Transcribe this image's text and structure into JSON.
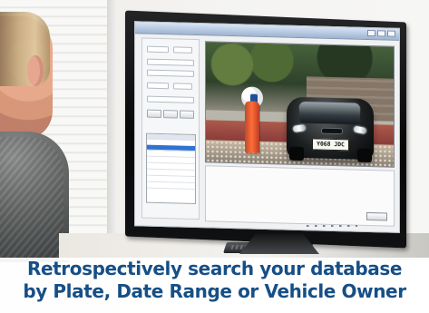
{
  "overlay": {
    "headline_line_1": "Retrospectively search your database",
    "headline_line_2": "by Plate, Date Range or Vehicle Owner"
  },
  "screen": {
    "plate_text": "Y068 JDC"
  },
  "colors": {
    "headline": "#164f86",
    "accent_orange": "#ff6d35",
    "selection_blue": "#2e72d2"
  }
}
